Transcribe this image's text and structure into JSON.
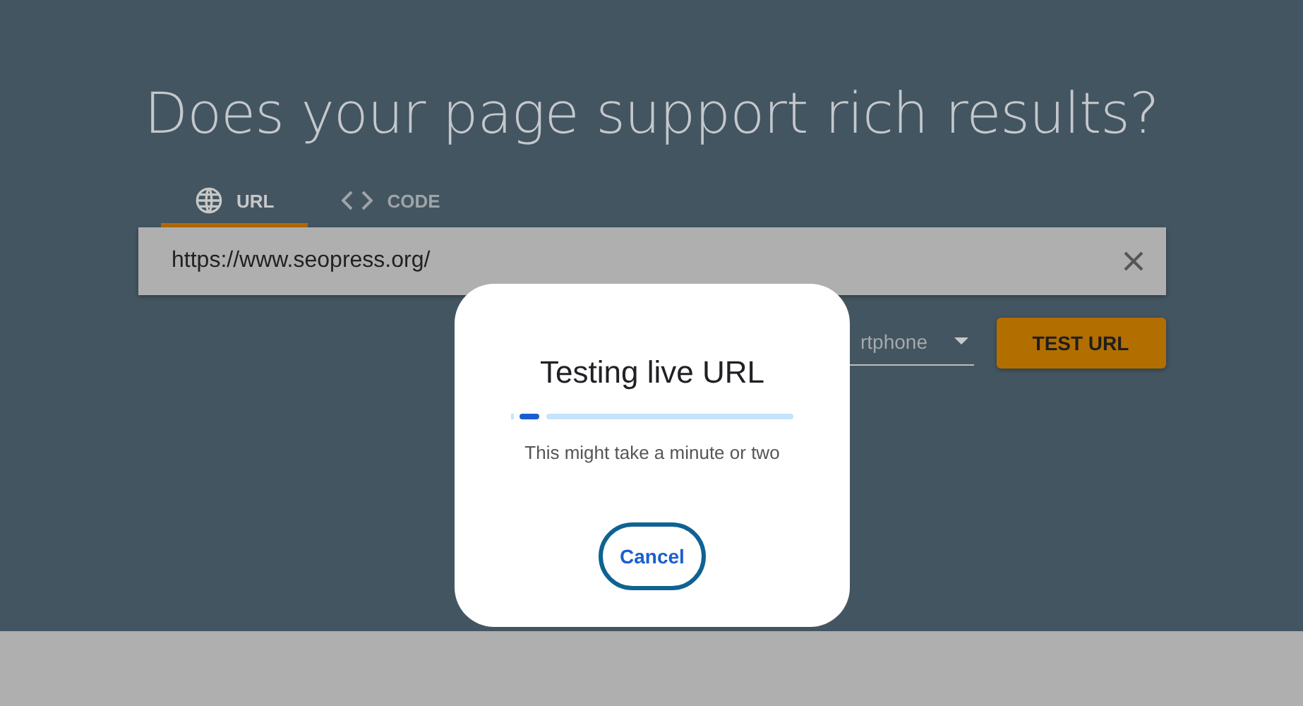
{
  "heading": "Does your page support rich results?",
  "tabs": [
    {
      "label": "URL",
      "kind": "globe",
      "selected": true
    },
    {
      "label": "CODE",
      "kind": "code",
      "selected": false
    }
  ],
  "url_field": {
    "value": "https://www.seopress.org/"
  },
  "device_select": {
    "value": "rtphone"
  },
  "test_button": "TEST URL",
  "dialog": {
    "title": "Testing live URL",
    "progress": {
      "level": 0.07
    },
    "message": "This might take a minute or two",
    "cancel": "Cancel"
  }
}
